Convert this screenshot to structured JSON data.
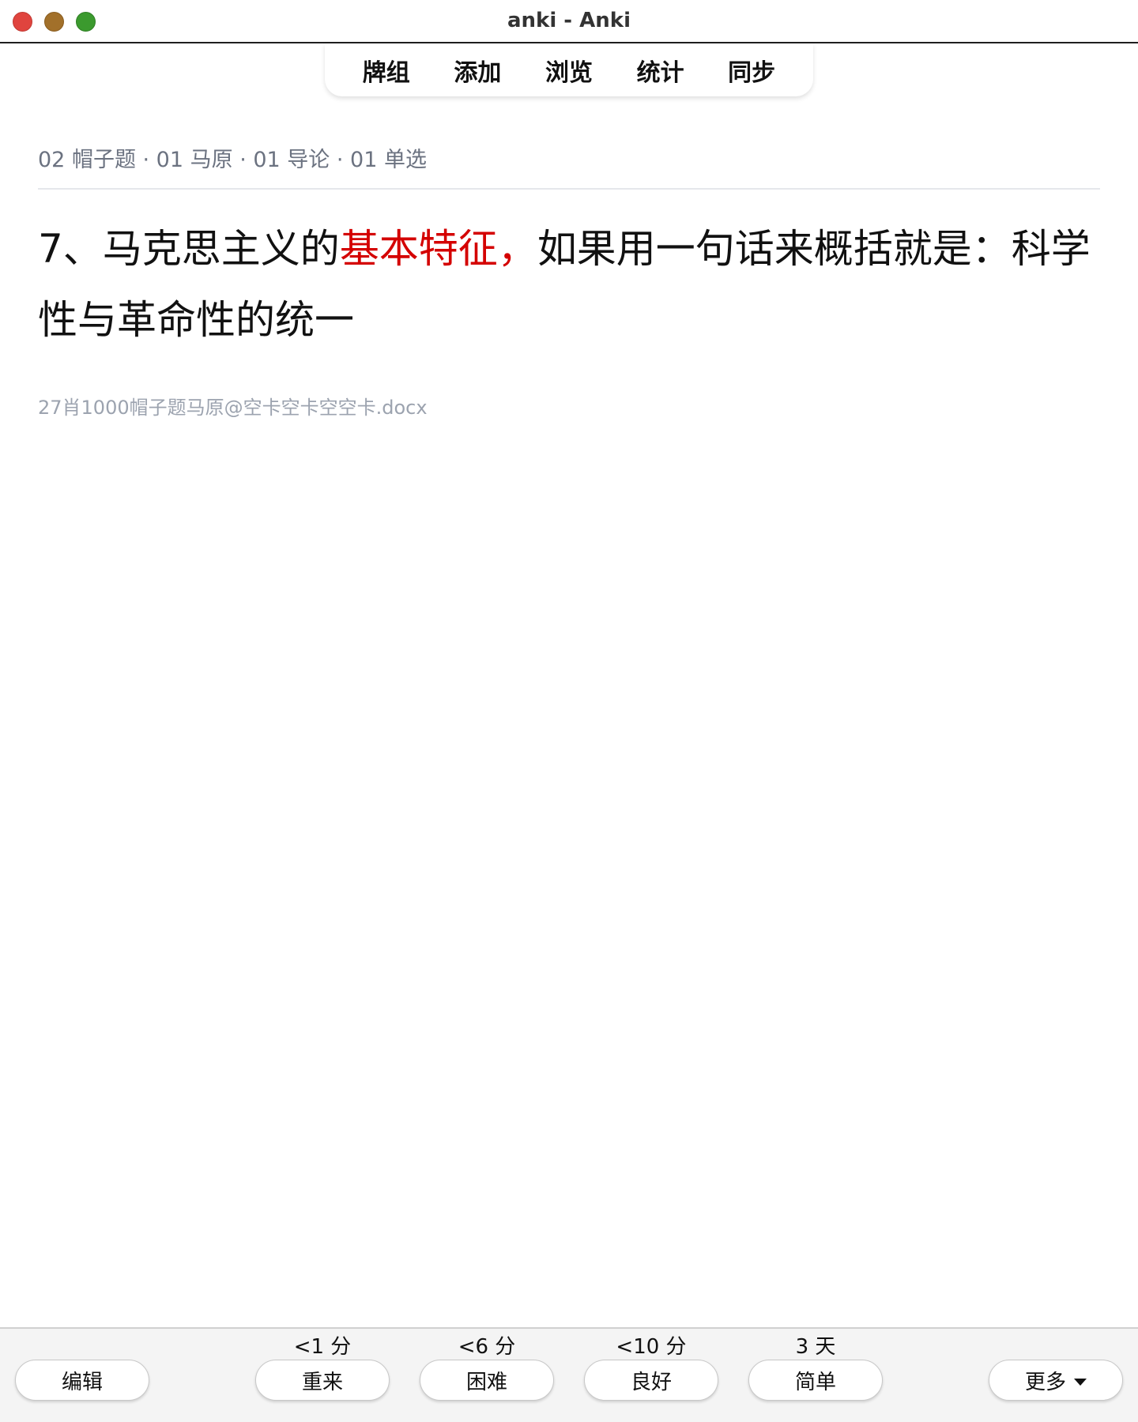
{
  "window": {
    "title": "anki - Anki"
  },
  "toolbar": {
    "items": [
      {
        "label": "牌组"
      },
      {
        "label": "添加"
      },
      {
        "label": "浏览"
      },
      {
        "label": "统计"
      },
      {
        "label": "同步"
      }
    ]
  },
  "card": {
    "deck_path": "02 帽子题 · 01 马原 · 01 导论 · 01 单选",
    "question_before": "7、马克思主义的",
    "question_highlight": "基本特征，",
    "question_after": "如果用一句话来概括就是：科学性与革命性的统一",
    "source": "27肖1000帽子题马原@空卡空卡空空卡.docx",
    "highlight_color": "#d40000"
  },
  "answer_bar": {
    "edit_label": "编辑",
    "more_label": "更多",
    "buttons": [
      {
        "interval": "<1 分",
        "label": "重来"
      },
      {
        "interval": "<6 分",
        "label": "困难"
      },
      {
        "interval": "<10 分",
        "label": "良好"
      },
      {
        "interval": "3 天",
        "label": "简单"
      }
    ]
  }
}
